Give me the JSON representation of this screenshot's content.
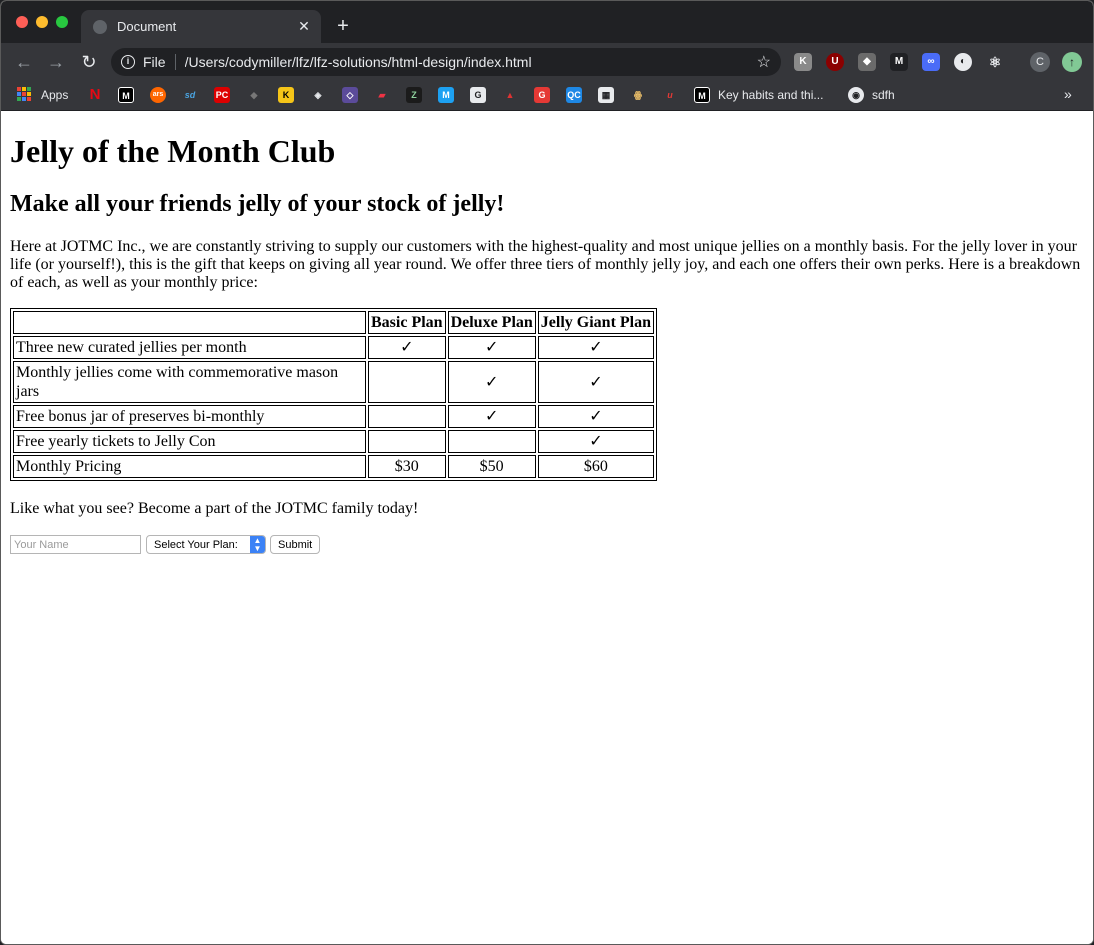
{
  "browser": {
    "tab_title": "Document",
    "url_scheme": "File",
    "url": "/Users/codymiller/lfz/lfz-solutions/html-design/index.html",
    "profile_initial": "C",
    "bookmarks": {
      "apps_label": "Apps",
      "key_habits_label": "Key habits and thi...",
      "sdfh_label": "sdfh"
    }
  },
  "page": {
    "title": "Jelly of the Month Club",
    "subtitle": "Make all your friends jelly of your stock of jelly!",
    "intro": "Here at JOTMC Inc., we are constantly striving to supply our customers with the highest-quality and most unique jellies on a monthly basis. For the jelly lover in your life (or yourself!), this is the gift that keeps on giving all year round. We offer three tiers of monthly jelly joy, and each one offers their own perks. Here is a breakdown of each, as well as your monthly price:",
    "table": {
      "headers": [
        "",
        "Basic Plan",
        "Deluxe Plan",
        "Jelly Giant Plan"
      ],
      "rows": [
        [
          "Three new curated jellies per month",
          "✓",
          "✓",
          "✓"
        ],
        [
          "Monthly jellies come with commemorative mason jars",
          "",
          "✓",
          "✓"
        ],
        [
          "Free bonus jar of preserves bi-monthly",
          "",
          "✓",
          "✓"
        ],
        [
          "Free yearly tickets to Jelly Con",
          "",
          "",
          "✓"
        ],
        [
          "Monthly Pricing",
          "$30",
          "$50",
          "$60"
        ]
      ]
    },
    "cta": "Like what you see? Become a part of the JOTMC family today!",
    "form": {
      "name_placeholder": "Your Name",
      "select_label": "Select Your Plan:",
      "submit_label": "Submit"
    }
  }
}
